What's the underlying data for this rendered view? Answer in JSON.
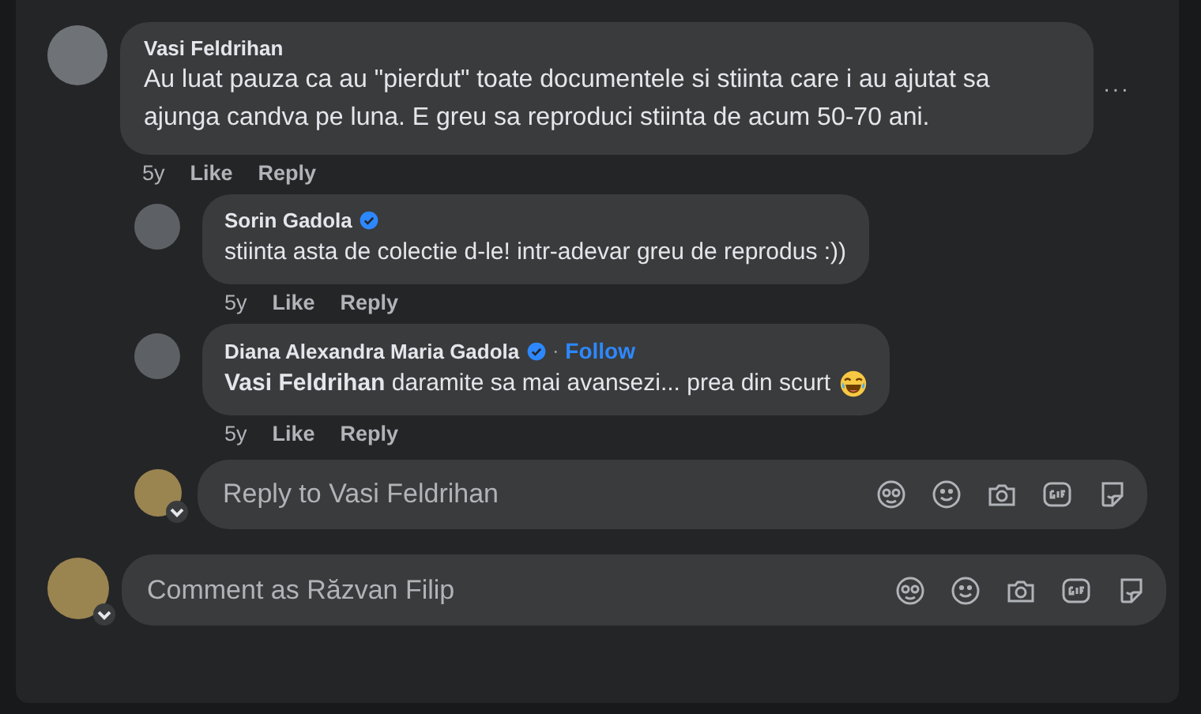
{
  "comments": [
    {
      "author": "Vasi Feldrihan",
      "text": "Au luat pauza ca au \"pierdut\" toate documentele si stiinta care i au ajutat sa ajunga candva pe luna. E greu sa reproduci stiinta de acum 50-70 ani.",
      "time": "5y",
      "like": "Like",
      "reply": "Reply",
      "menu": "···",
      "replies": [
        {
          "author": "Sorin Gadola",
          "verified": true,
          "text": "stiinta asta de colectie d-le! intr-adevar greu de reprodus :))",
          "time": "5y",
          "like": "Like",
          "reply": "Reply"
        },
        {
          "author": "Diana Alexandra Maria Gadola",
          "verified": true,
          "separator": "·",
          "follow": "Follow",
          "text": "**Vasi Feldrihan** daramite sa mai avansezi... prea din scurt",
          "emoji": true,
          "time": "5y",
          "like": "Like",
          "reply": "Reply"
        }
      ]
    }
  ],
  "reply_box": {
    "placeholder": "Reply to Vasi Feldrihan"
  },
  "comment_box": {
    "placeholder": "Comment as Răzvan Filip"
  }
}
